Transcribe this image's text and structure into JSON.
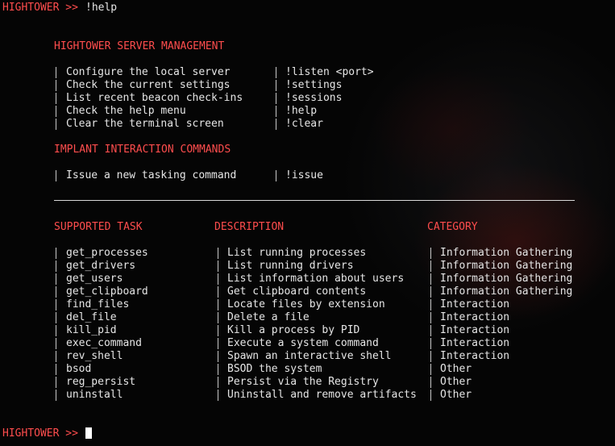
{
  "colors": {
    "prompt": "#ff4d4d",
    "heading": "#ff4d4d",
    "text": "#e6e6e6",
    "background": "#050505"
  },
  "prompt": "HIGHTOWER >>",
  "command": "!help",
  "server_section": {
    "title": "HIGHTOWER SERVER MANAGEMENT",
    "rows": [
      {
        "description": "Configure the local server",
        "command": "!listen <port>"
      },
      {
        "description": "Check the current settings",
        "command": "!settings"
      },
      {
        "description": "List recent beacon check-ins",
        "command": "!sessions"
      },
      {
        "description": "Check the help menu",
        "command": "!help"
      },
      {
        "description": "Clear the terminal screen",
        "command": "!clear"
      }
    ]
  },
  "implant_section": {
    "title": "IMPLANT INTERACTION COMMANDS",
    "rows": [
      {
        "description": "Issue a new tasking command",
        "command": "!issue"
      }
    ]
  },
  "tasks_table": {
    "headers": {
      "task": "SUPPORTED TASK",
      "description": "DESCRIPTION",
      "category": "CATEGORY"
    },
    "rows": [
      {
        "task": "get_processes",
        "description": "List running processes",
        "category": "Information Gathering"
      },
      {
        "task": "get_drivers",
        "description": "List running drivers",
        "category": "Information Gathering"
      },
      {
        "task": "get_users",
        "description": "List information about users",
        "category": "Information Gathering"
      },
      {
        "task": "get_clipboard",
        "description": "Get clipboard contents",
        "category": "Information Gathering"
      },
      {
        "task": "find_files",
        "description": "Locate files by extension",
        "category": "Interaction"
      },
      {
        "task": "del_file",
        "description": "Delete a file",
        "category": "Interaction"
      },
      {
        "task": "kill_pid",
        "description": "Kill a process by PID",
        "category": "Interaction"
      },
      {
        "task": "exec_command",
        "description": "Execute a system command",
        "category": "Interaction"
      },
      {
        "task": "rev_shell",
        "description": "Spawn an interactive shell",
        "category": "Interaction"
      },
      {
        "task": "bsod",
        "description": "BSOD the system",
        "category": "Other"
      },
      {
        "task": "reg_persist",
        "description": "Persist via the Registry",
        "category": "Other"
      },
      {
        "task": "uninstall",
        "description": "Uninstall and remove artifacts",
        "category": "Other"
      }
    ]
  },
  "input_prompt": "HIGHTOWER >>"
}
